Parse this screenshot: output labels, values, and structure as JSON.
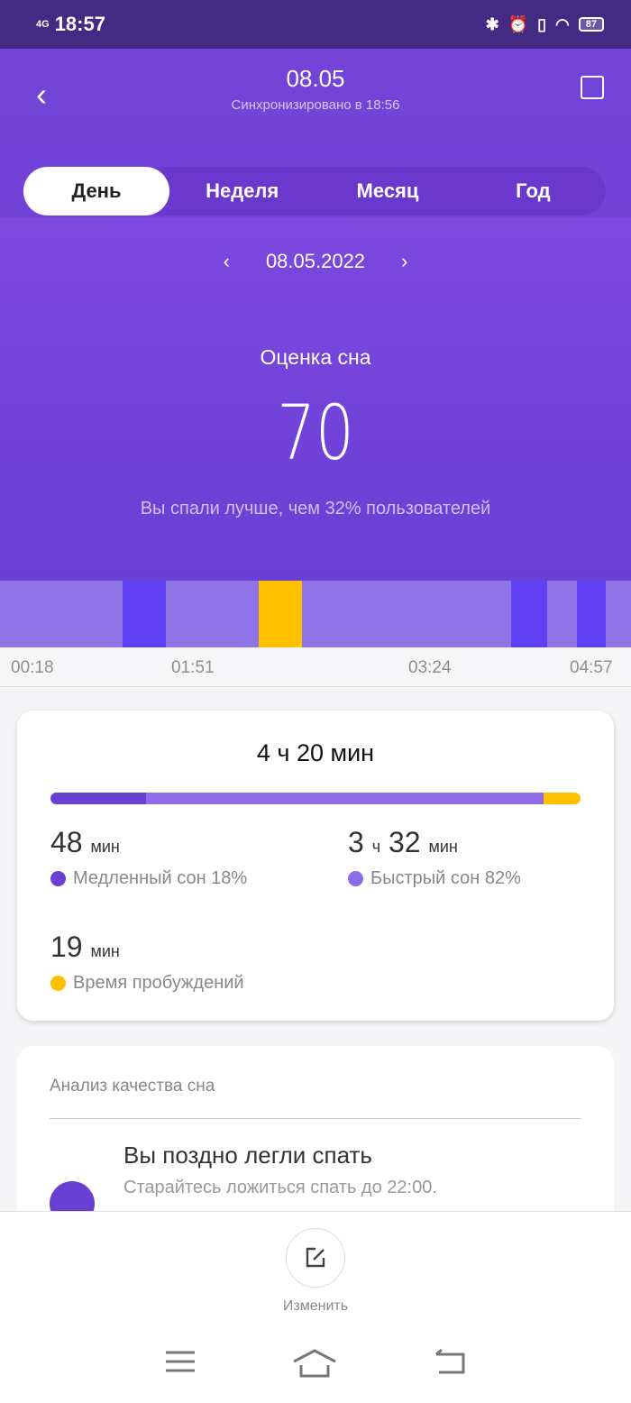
{
  "status_bar": {
    "network": "4G",
    "time": "18:57",
    "battery": "87"
  },
  "header": {
    "title": "08.05",
    "subtitle": "Синхронизировано в 18:56"
  },
  "tabs": [
    {
      "label": "День",
      "active": true
    },
    {
      "label": "Неделя"
    },
    {
      "label": "Месяц"
    },
    {
      "label": "Год"
    }
  ],
  "date_nav": {
    "date": "08.05.2022"
  },
  "score": {
    "label": "Оценка сна",
    "value": "70",
    "comparison": "Вы спали лучше, чем 32% пользователей"
  },
  "colors": {
    "light": "#8f74e8",
    "deep": "#5f40f2",
    "awake": "#ffc000",
    "accent": "#6a3fd4"
  },
  "timeline": {
    "segments": [
      {
        "stage": "light",
        "share": 19.4
      },
      {
        "stage": "deep",
        "share": 6.9
      },
      {
        "stage": "light",
        "share": 14.7
      },
      {
        "stage": "awake",
        "share": 6.9
      },
      {
        "stage": "light",
        "share": 33.1
      },
      {
        "stage": "deep",
        "share": 5.7
      },
      {
        "stage": "light",
        "share": 4.7
      },
      {
        "stage": "deep",
        "share": 4.6
      },
      {
        "stage": "light",
        "share": 4
      }
    ],
    "ticks": [
      "00:18",
      "01:51",
      "03:24",
      "04:57"
    ]
  },
  "summary": {
    "total": "4 ч 20 мин",
    "deep": {
      "value": "48",
      "unit": "мин",
      "label": "Медленный сон 18%",
      "percent": 18,
      "color": "#6a3fd4"
    },
    "light": {
      "hours": "3",
      "h_unit": "ч",
      "value": "32",
      "unit": "мин",
      "label": "Быстрый сон 82%",
      "percent": 75,
      "color": "#8e6ce8"
    },
    "awake": {
      "value": "19",
      "unit": "мин",
      "label": "Время пробуждений",
      "percent": 7,
      "color": "#ffc000"
    }
  },
  "analysis": {
    "heading": "Анализ качества сна",
    "title": "Вы поздно легли спать",
    "description": "Старайтесь ложиться спать до 22:00."
  },
  "bottom": {
    "edit_label": "Изменить"
  }
}
